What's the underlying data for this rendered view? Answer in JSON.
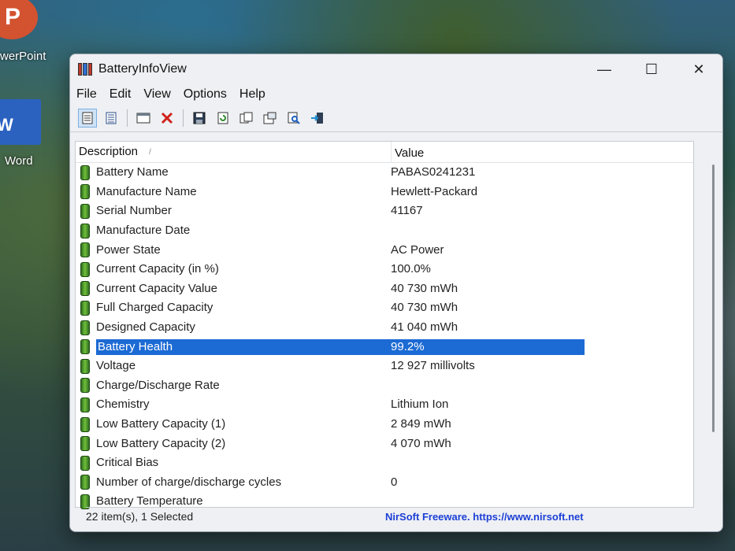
{
  "desktop": {
    "powerpoint_label": "werPoint",
    "powerpoint_letter": "P",
    "word_label": "Word",
    "word_letter": "W"
  },
  "window": {
    "title": "BatteryInfoView",
    "controls": {
      "minimize": "—",
      "maximize": "☐",
      "close": "✕"
    }
  },
  "menu": [
    "File",
    "Edit",
    "View",
    "Options",
    "Help"
  ],
  "toolbar": {
    "icons": [
      "list-view-icon",
      "details-view-icon",
      "window-icon",
      "delete-icon",
      "save-icon",
      "refresh-icon",
      "copy-icon",
      "properties-icon",
      "find-icon",
      "exit-icon"
    ]
  },
  "table": {
    "columns": [
      "Description",
      "Value"
    ],
    "rows": [
      {
        "description": "Battery Name",
        "value": "PABAS0241231"
      },
      {
        "description": "Manufacture Name",
        "value": "Hewlett-Packard"
      },
      {
        "description": "Serial Number",
        "value": "41167"
      },
      {
        "description": "Manufacture Date",
        "value": ""
      },
      {
        "description": "Power State",
        "value": "AC Power"
      },
      {
        "description": "Current Capacity (in %)",
        "value": "100.0%"
      },
      {
        "description": "Current Capacity Value",
        "value": "40 730 mWh"
      },
      {
        "description": "Full Charged Capacity",
        "value": "40 730 mWh"
      },
      {
        "description": "Designed Capacity",
        "value": "41 040 mWh"
      },
      {
        "description": "Battery Health",
        "value": "99.2%",
        "selected": true
      },
      {
        "description": "Voltage",
        "value": "12 927 millivolts"
      },
      {
        "description": "Charge/Discharge Rate",
        "value": ""
      },
      {
        "description": "Chemistry",
        "value": "Lithium Ion"
      },
      {
        "description": "Low Battery Capacity (1)",
        "value": "2 849 mWh"
      },
      {
        "description": "Low Battery Capacity (2)",
        "value": "4 070 mWh"
      },
      {
        "description": "Critical Bias",
        "value": ""
      },
      {
        "description": "Number of charge/discharge cycles",
        "value": "0"
      },
      {
        "description": "Battery Temperature",
        "value": ""
      }
    ]
  },
  "status": {
    "items": "22 item(s), 1 Selected",
    "credit": "NirSoft Freeware. https://www.nirsoft.net"
  },
  "colors": {
    "selection": "#1c6ad4",
    "link": "#1c3fd6"
  }
}
